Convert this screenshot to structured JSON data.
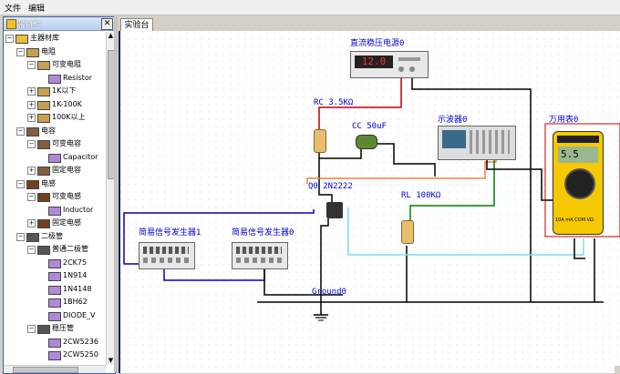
{
  "menu": {
    "items": [
      {
        "label": "文件"
      },
      {
        "label": "编辑"
      }
    ]
  },
  "panel": {
    "title": "器材栏",
    "close": "✕"
  },
  "tree": [
    {
      "label": "主器材库",
      "icon": "folder-icon",
      "exp": "−"
    },
    {
      "label": "电阻",
      "icon": "resistor-icon",
      "exp": "−"
    },
    {
      "label": "可变电阻",
      "icon": "resistor-icon",
      "exp": "−"
    },
    {
      "label": "Resistor",
      "icon": "component-icon",
      "exp": ""
    },
    {
      "label": "1K以下",
      "icon": "resistor-icon",
      "exp": "+"
    },
    {
      "label": "1K-100K",
      "icon": "resistor-icon",
      "exp": "+"
    },
    {
      "label": "100K以上",
      "icon": "resistor-icon",
      "exp": "+"
    },
    {
      "label": "电容",
      "icon": "capacitor-icon",
      "exp": "−"
    },
    {
      "label": "可变电容",
      "icon": "capacitor-icon",
      "exp": "−"
    },
    {
      "label": "Capacitor",
      "icon": "component-icon",
      "exp": ""
    },
    {
      "label": "固定电容",
      "icon": "capacitor-icon",
      "exp": "+"
    },
    {
      "label": "电感",
      "icon": "inductor-icon",
      "exp": "−"
    },
    {
      "label": "可变电感",
      "icon": "inductor-icon",
      "exp": "−"
    },
    {
      "label": "Inductor",
      "icon": "component-icon",
      "exp": ""
    },
    {
      "label": "固定电感",
      "icon": "inductor-icon",
      "exp": "+"
    },
    {
      "label": "二极管",
      "icon": "diode-icon",
      "exp": "−"
    },
    {
      "label": "普通二极管",
      "icon": "diode-icon",
      "exp": "−"
    },
    {
      "label": "2CK75",
      "icon": "component-icon",
      "exp": ""
    },
    {
      "label": "1N914",
      "icon": "component-icon",
      "exp": ""
    },
    {
      "label": "1N4148",
      "icon": "component-icon",
      "exp": ""
    },
    {
      "label": "1BH62",
      "icon": "component-icon",
      "exp": ""
    },
    {
      "label": "DIODE_V",
      "icon": "component-icon",
      "exp": ""
    },
    {
      "label": "稳压管",
      "icon": "diode-icon",
      "exp": "−"
    },
    {
      "label": "2CW5236",
      "icon": "component-icon",
      "exp": ""
    },
    {
      "label": "2CW5250",
      "icon": "component-icon",
      "exp": ""
    }
  ],
  "tab": {
    "label": "实验台"
  },
  "circuit": {
    "dc_supply": {
      "label": "直流稳压电源0",
      "display": "12.0"
    },
    "rc": {
      "label": "RC  3.5KΩ"
    },
    "cc": {
      "label": "CC  50uF"
    },
    "transistor": {
      "label": "Q0  2N2222"
    },
    "rl": {
      "label": "RL  100KΩ"
    },
    "scope": {
      "label": "示波器0"
    },
    "meter": {
      "label": "万用表0",
      "display": "5.5",
      "ports": [
        "10A",
        "mA",
        "COM",
        "VΩ"
      ]
    },
    "gen1": {
      "label": "简易信号发生器1"
    },
    "gen0": {
      "label": "简易信号发生器0"
    },
    "ground": {
      "label": "Ground0"
    }
  },
  "colors": {
    "accent": "#0a246a",
    "canvas": "#ffffff",
    "wire_red": "#c00000",
    "wire_blue": "#0000c0",
    "wire_green": "#008000",
    "wire_orange": "#f08040",
    "wire_cyan": "#80d8f0",
    "meter_yellow": "#f5c800"
  }
}
